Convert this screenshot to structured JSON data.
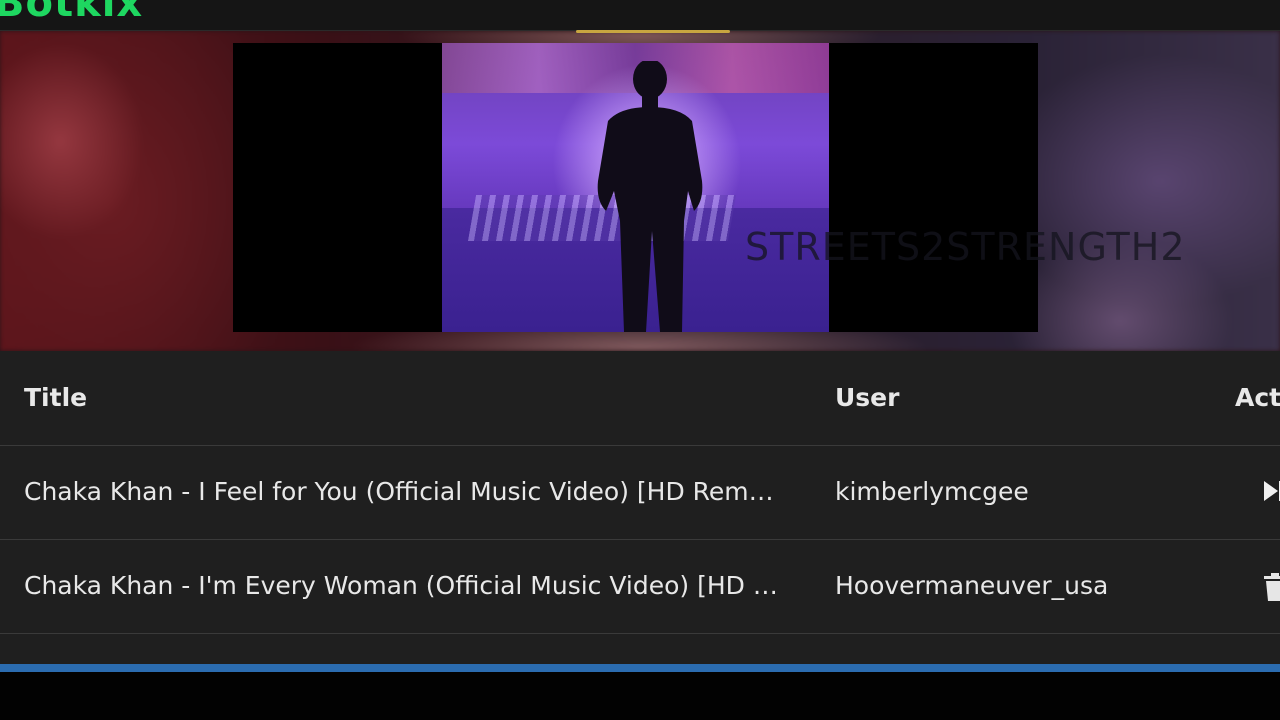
{
  "app": {
    "logo_text": "Botkix",
    "brand_color": "#1ed760"
  },
  "player": {
    "watermark": "STREETS2STRENGTH2"
  },
  "table": {
    "columns": {
      "title": "Title",
      "user": "User",
      "actions": "Acti"
    },
    "rows": [
      {
        "title": "Chaka Khan - I Feel for You (Official Music Video) [HD Rema...",
        "user": "kimberlymcgee",
        "action_icon": "play-next-icon"
      },
      {
        "title": "Chaka Khan - I'm Every Woman (Official Music Video) [HD R...",
        "user": "Hoovermaneuver_usa",
        "action_icon": "trash-icon"
      }
    ]
  },
  "progress": {
    "fraction": 1.0,
    "color": "#2b6cb0"
  }
}
